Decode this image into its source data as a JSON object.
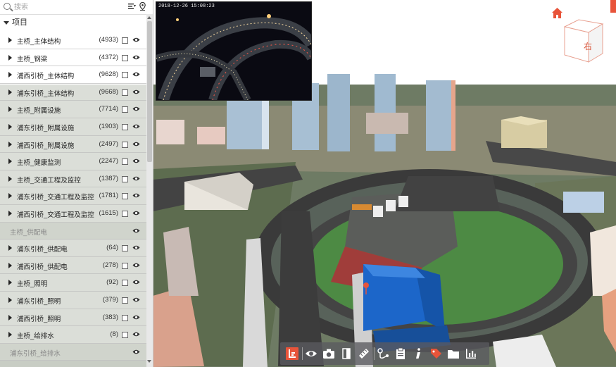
{
  "search": {
    "placeholder": "搜索"
  },
  "tree": {
    "root_label": "项目",
    "items": [
      {
        "label": "主桥_主体结构",
        "count": "(4933)",
        "enabled": true
      },
      {
        "label": "主桥_钢梁",
        "count": "(4372)",
        "enabled": true
      },
      {
        "label": "浦西引桥_主体结构",
        "count": "(9628)",
        "enabled": true
      },
      {
        "label": "浦东引桥_主体结构",
        "count": "(9668)",
        "enabled": true
      },
      {
        "label": "主桥_附属设施",
        "count": "(7714)",
        "enabled": true
      },
      {
        "label": "浦东引桥_附属设施",
        "count": "(1903)",
        "enabled": true
      },
      {
        "label": "浦西引桥_附属设施",
        "count": "(2497)",
        "enabled": true
      },
      {
        "label": "主桥_健康监测",
        "count": "(2247)",
        "enabled": true
      },
      {
        "label": "主桥_交通工程及监控",
        "count": "(1387)",
        "enabled": true
      },
      {
        "label": "浦东引桥_交通工程及监控",
        "count": "(1781)",
        "enabled": true
      },
      {
        "label": "浦西引桥_交通工程及监控",
        "count": "(1615)",
        "enabled": true
      },
      {
        "label": "主桥_供配电",
        "count": "",
        "enabled": false
      },
      {
        "label": "浦东引桥_供配电",
        "count": "(64)",
        "enabled": true
      },
      {
        "label": "浦西引桥_供配电",
        "count": "(278)",
        "enabled": true
      },
      {
        "label": "主桥_照明",
        "count": "(92)",
        "enabled": true
      },
      {
        "label": "浦东引桥_照明",
        "count": "(379)",
        "enabled": true
      },
      {
        "label": "浦西引桥_照明",
        "count": "(383)",
        "enabled": true
      },
      {
        "label": "主桥_给排水",
        "count": "(8)",
        "enabled": true
      },
      {
        "label": "浦东引桥_给排水",
        "count": "",
        "enabled": false
      }
    ]
  },
  "video": {
    "timestamp": "2018-12-26 15:08:23"
  },
  "view_cube": {
    "face_label": "右"
  },
  "toolbar": {
    "icons": [
      "layers-icon",
      "eye-icon",
      "camera-icon",
      "split-view-icon",
      "measure-ruler-icon",
      "path-icon",
      "clipboard-icon",
      "info-icon",
      "tag-icon",
      "folder-icon",
      "chart-icon"
    ]
  },
  "colors": {
    "accent": "#e8543a",
    "selected_building": "#1c66c9"
  }
}
